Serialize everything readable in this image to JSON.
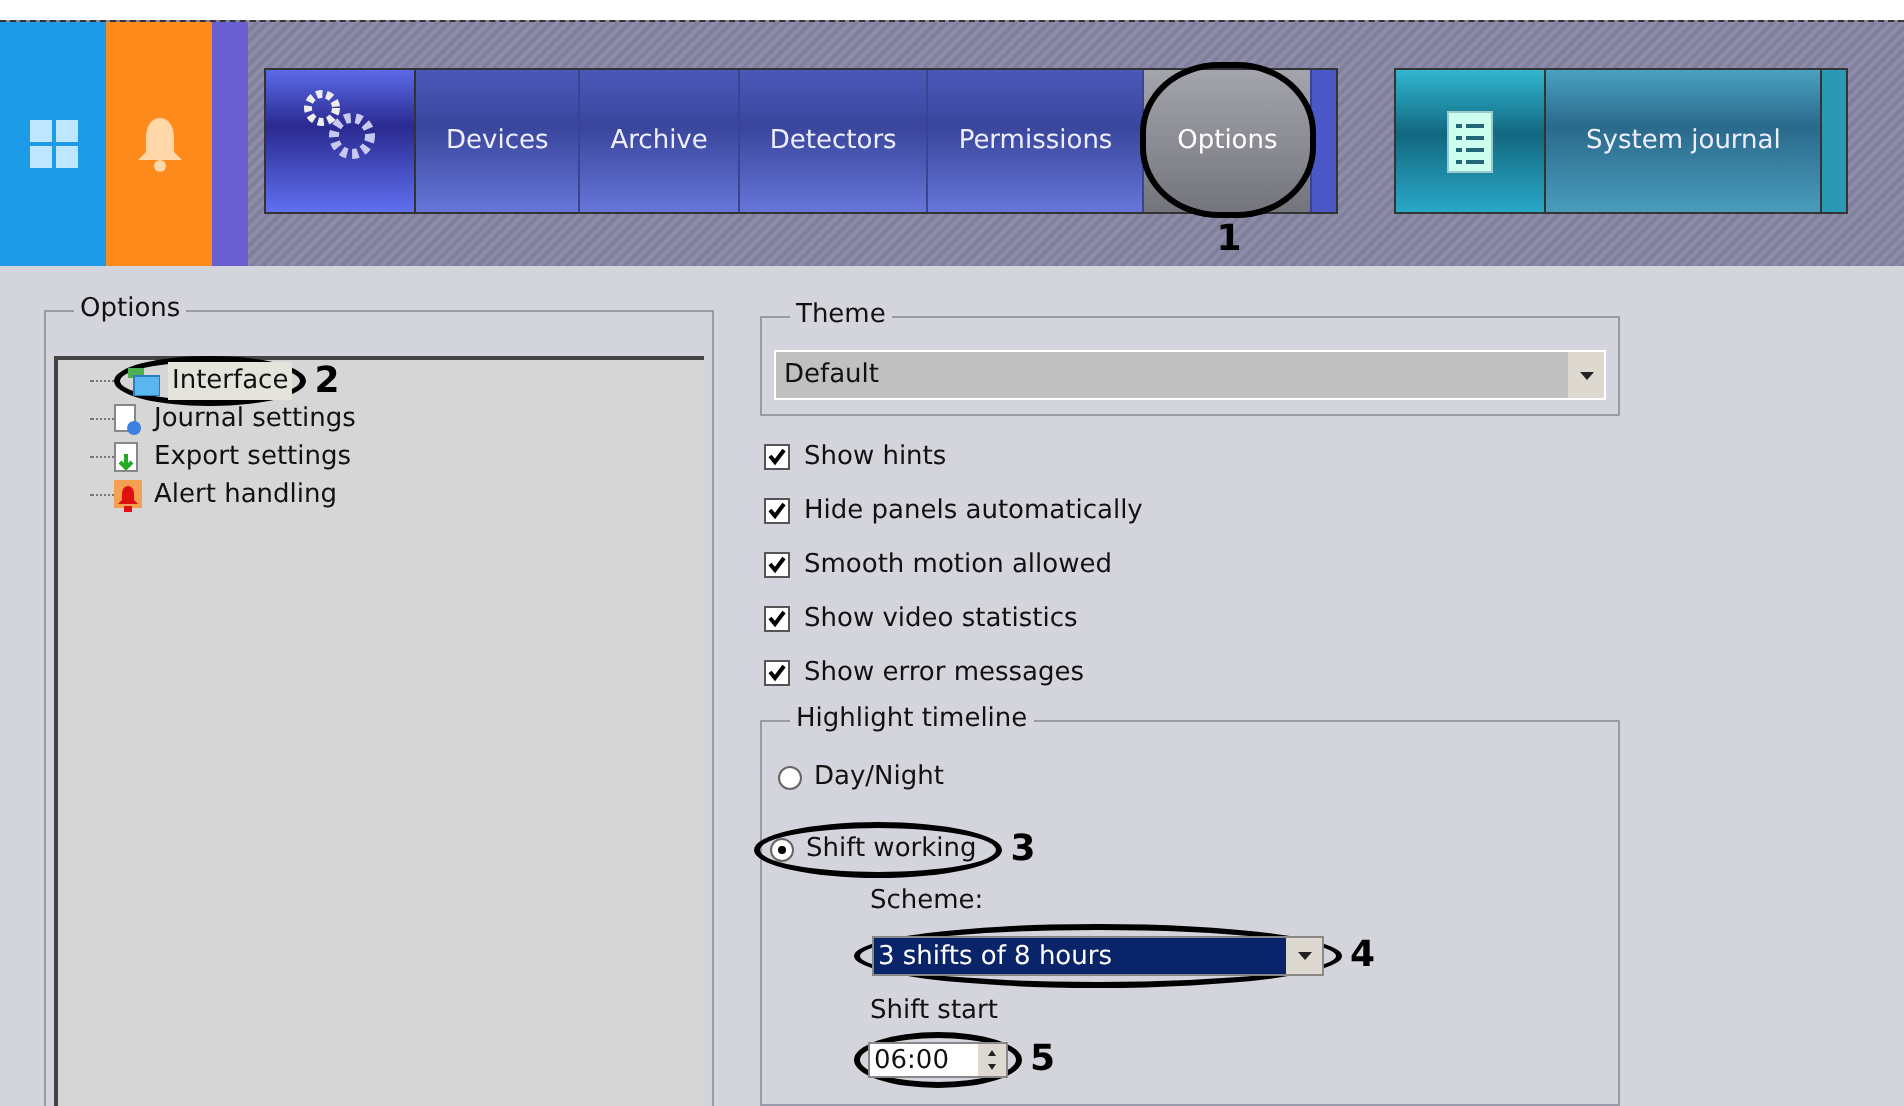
{
  "nav": {
    "tabs": [
      {
        "label": "Devices",
        "selected": false
      },
      {
        "label": "Archive",
        "selected": false
      },
      {
        "label": "Detectors",
        "selected": false
      },
      {
        "label": "Permissions",
        "selected": false
      },
      {
        "label": "Options",
        "selected": true,
        "callout": "1"
      }
    ]
  },
  "journal": {
    "label": "System journal"
  },
  "options_panel": {
    "title": "Options",
    "tree": [
      {
        "label": "Interface",
        "kind": "interface",
        "selected": true,
        "callout": "2"
      },
      {
        "label": "Journal settings",
        "kind": "journal",
        "selected": false
      },
      {
        "label": "Export settings",
        "kind": "export",
        "selected": false
      },
      {
        "label": "Alert handling",
        "kind": "alert",
        "selected": false
      }
    ]
  },
  "theme": {
    "title": "Theme",
    "value": "Default"
  },
  "checkboxes": [
    {
      "label": "Show hints",
      "checked": true
    },
    {
      "label": "Hide panels automatically",
      "checked": true
    },
    {
      "label": "Smooth motion allowed",
      "checked": true
    },
    {
      "label": "Show video statistics",
      "checked": true
    },
    {
      "label": "Show error messages",
      "checked": true
    }
  ],
  "highlight_timeline": {
    "title": "Highlight timeline",
    "options": [
      {
        "label": "Day/Night",
        "selected": false
      },
      {
        "label": "Shift working",
        "selected": true,
        "callout": "3"
      }
    ],
    "scheme": {
      "label": "Scheme:",
      "value": "3 shifts of 8 hours",
      "callout": "4"
    },
    "shift_start": {
      "label": "Shift start",
      "value": "06:00",
      "callout": "5"
    }
  }
}
